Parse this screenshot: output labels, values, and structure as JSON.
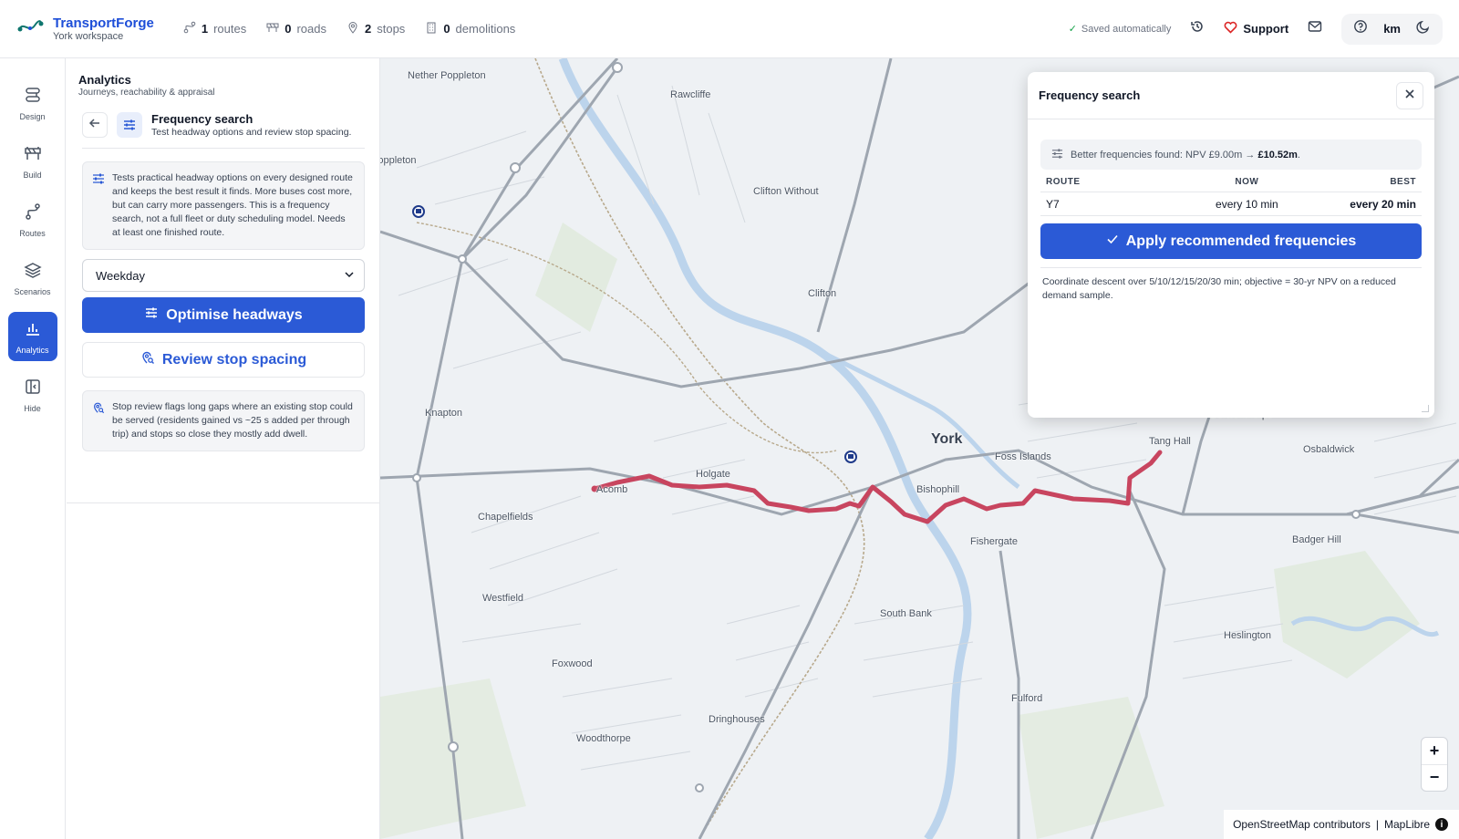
{
  "app": {
    "name": "TransportForge",
    "workspace": "York workspace"
  },
  "stats": [
    {
      "icon": "route-icon",
      "count": "1",
      "label": "routes"
    },
    {
      "icon": "road-icon",
      "count": "0",
      "label": "roads"
    },
    {
      "icon": "pin-icon",
      "count": "2",
      "label": "stops"
    },
    {
      "icon": "building-icon",
      "count": "0",
      "label": "demolitions"
    }
  ],
  "header": {
    "saved_text": "Saved automatically",
    "support_label": "Support",
    "units_label": "km"
  },
  "rail": [
    {
      "label": "Design",
      "icon": "design-icon",
      "active": false
    },
    {
      "label": "Build",
      "icon": "roadblock-icon",
      "active": false
    },
    {
      "label": "Routes",
      "icon": "routes-icon",
      "active": false
    },
    {
      "label": "Scenarios",
      "icon": "layers-icon",
      "active": false
    },
    {
      "label": "Analytics",
      "icon": "bar-chart-icon",
      "active": true
    },
    {
      "label": "Hide",
      "icon": "collapse-panel-icon",
      "active": false
    }
  ],
  "panel": {
    "title": "Analytics",
    "subtitle": "Journeys, reachability & appraisal",
    "section_title": "Frequency search",
    "section_desc": "Test headway options and review stop spacing.",
    "info_text": "Tests practical headway options on every designed route and keeps the best result it finds. More buses cost more, but can carry more passengers. This is a frequency search, not a full fleet or duty scheduling model. Needs at least one finished route.",
    "day_select": "Weekday",
    "optimise_label": "Optimise headways",
    "review_label": "Review stop spacing",
    "stop_info_text": "Stop review flags long gaps where an existing stop could be served (residents gained vs ~25 s added per through trip) and stops so close they mostly add dwell."
  },
  "dialog": {
    "title": "Frequency search",
    "result_prefix": "Better frequencies found: NPV £9.00m → ",
    "result_value": "£10.52m",
    "result_suffix": ".",
    "columns": {
      "route": "ROUTE",
      "now": "NOW",
      "best": "BEST"
    },
    "rows": [
      {
        "route": "Y7",
        "now": "every 10 min",
        "best": "every 20 min"
      }
    ],
    "apply_label": "Apply recommended frequencies",
    "note": "Coordinate descent over 5/10/12/15/20/30 min; objective = 30-yr NPV on a reduced demand sample."
  },
  "map": {
    "places": [
      "Nether Poppleton",
      "Rawcliffe",
      "Poppleton",
      "Clifton Without",
      "Clifton",
      "Knapton",
      "York",
      "Foss Islands",
      "Derwenthorpe",
      "Tang Hall",
      "Osbaldwick",
      "Holgate",
      "Acomb",
      "Bishophill",
      "Chapelfields",
      "Fishergate",
      "Badger Hill",
      "Westfield",
      "South Bank",
      "Heslington",
      "Foxwood",
      "Fulford",
      "Dringhouses",
      "Woodthorpe"
    ],
    "attribution_osm": "OpenStreetMap contributors",
    "attribution_sep": "|",
    "attribution_lib": "MapLibre",
    "zoom_in": "+",
    "zoom_out": "−",
    "route_color": "#c8455f"
  }
}
